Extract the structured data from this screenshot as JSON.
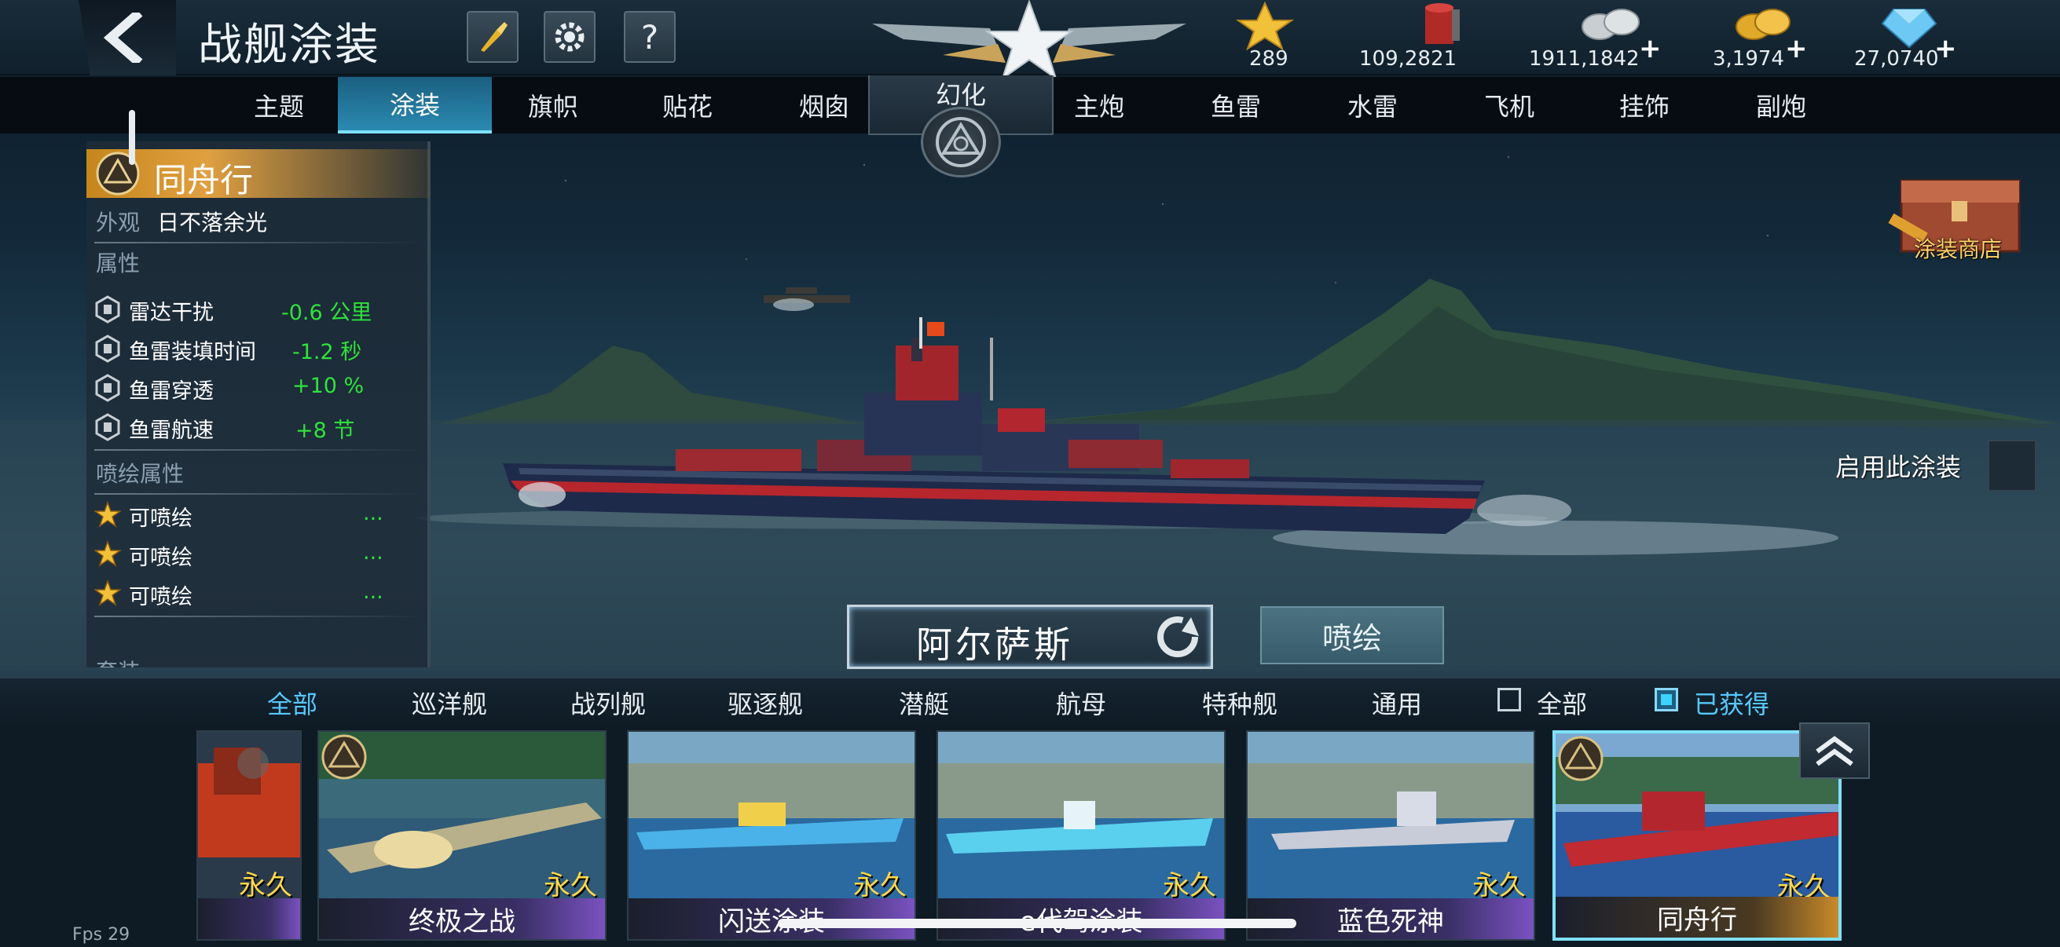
{
  "header": {
    "title": "战舰涂装"
  },
  "resources": [
    {
      "name": "star-rank",
      "value": "289"
    },
    {
      "name": "paint",
      "value": "109,2821"
    },
    {
      "name": "silver",
      "value": "1911,1842"
    },
    {
      "name": "gold",
      "value": "3,1974"
    },
    {
      "name": "diamond",
      "value": "27,0740"
    }
  ],
  "tabs": [
    "主题",
    "涂装",
    "旗帜",
    "贴花",
    "烟囱",
    "主炮",
    "鱼雷",
    "水雷",
    "飞机",
    "挂饰",
    "副炮"
  ],
  "active_tab": "涂装",
  "huanhua": "幻化",
  "skin": {
    "name": "同舟行",
    "appearance_label": "外观",
    "appearance_value": "日不落余光",
    "attr_label": "属性",
    "attrs": [
      {
        "k": "雷达干扰",
        "v": "-0.6 公里"
      },
      {
        "k": "鱼雷装填时间",
        "v": "-1.2 秒"
      },
      {
        "k": "鱼雷穿透",
        "v": "+10 %"
      },
      {
        "k": "鱼雷航速",
        "v": "+8 节"
      }
    ],
    "spray_label": "喷绘属性",
    "spray_attrs": [
      {
        "k": "可喷绘",
        "v": "..."
      },
      {
        "k": "可喷绘",
        "v": "..."
      },
      {
        "k": "可喷绘",
        "v": "..."
      }
    ],
    "cut_label": "套装"
  },
  "shop_label": "涂装商店",
  "enable_label": "启用此涂装",
  "ship_name": "阿尔萨斯",
  "spray_button": "喷绘",
  "filters": [
    "全部",
    "巡洋舰",
    "战列舰",
    "驱逐舰",
    "潜艇",
    "航母",
    "特种舰",
    "通用"
  ],
  "active_filter": "全部",
  "checks": [
    {
      "label": "全部",
      "checked": false
    },
    {
      "label": "已获得",
      "checked": true
    }
  ],
  "cards": [
    {
      "name": "",
      "tag": "永久"
    },
    {
      "name": "终极之战",
      "tag": "永久"
    },
    {
      "name": "闪送涂装",
      "tag": "永久"
    },
    {
      "name": "e代驾涂装",
      "tag": "永久"
    },
    {
      "name": "蓝色死神",
      "tag": "永久"
    },
    {
      "name": "同舟行",
      "tag": "永久"
    }
  ],
  "fps": "Fps 29",
  "colors": {
    "accent": "#2b8ab2",
    "gold": "#ffd84a",
    "green": "#2fe33a"
  }
}
